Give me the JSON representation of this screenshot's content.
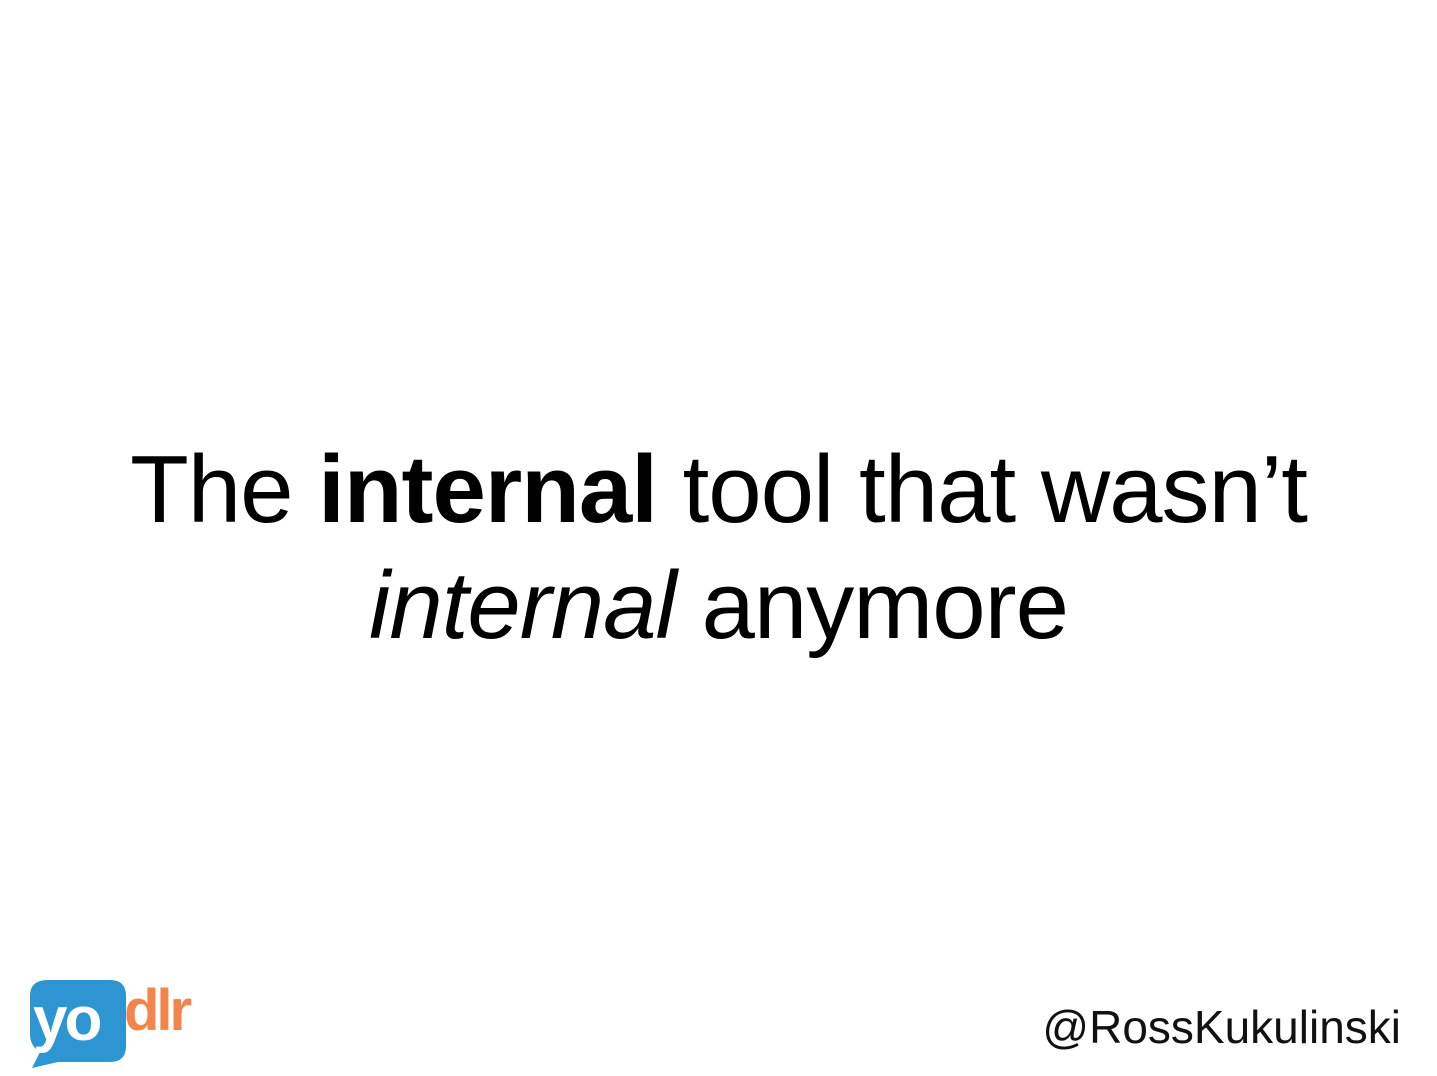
{
  "slide": {
    "headline": {
      "line1": {
        "before": "The ",
        "bold": "internal",
        "after": " tool that wasn’t"
      },
      "line2": {
        "italic": "internal",
        "after": " anymore"
      }
    },
    "logo": {
      "text_primary": "yo",
      "text_secondary": "dlr",
      "primary_color": "#2e95d3",
      "secondary_color": "#f4854a"
    },
    "handle": "@RossKukulinski"
  }
}
